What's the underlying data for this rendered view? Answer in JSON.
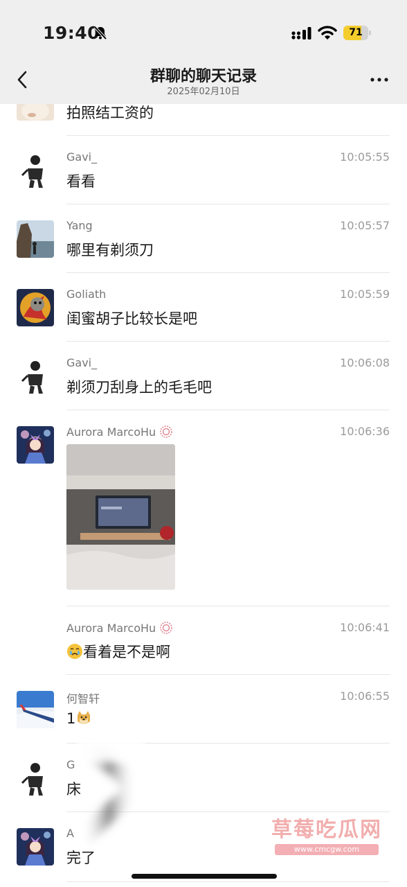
{
  "status_bar": {
    "time": "19:40",
    "battery": "71",
    "battery_level": 0.71
  },
  "header": {
    "title": "群聊的聊天记录",
    "subtitle": "2025年02月10日"
  },
  "messages": [
    {
      "sender": "",
      "time": "",
      "text": "拍照结工资的"
    },
    {
      "sender": "Gavi_",
      "time": "10:05:55",
      "text": "看看"
    },
    {
      "sender": "Yang",
      "time": "10:05:57",
      "text": "哪里有剃须刀"
    },
    {
      "sender": "Goliath",
      "time": "10:05:59",
      "text": "闺蜜胡子比较长是吧"
    },
    {
      "sender": "Gavi_",
      "time": "10:06:08",
      "text": "剃须刀刮身上的毛毛吧"
    },
    {
      "sender": "Aurora MarcoHu",
      "time": "10:06:36",
      "text": ""
    },
    {
      "sender": "Aurora MarcoHu",
      "time": "10:06:41",
      "text": "看着是不是啊"
    },
    {
      "sender": "何智轩",
      "time": "10:06:55",
      "text": "1"
    },
    {
      "sender": "G",
      "time": "",
      "text": "床"
    },
    {
      "sender": "A",
      "time": "",
      "text": "完了"
    }
  ],
  "watermark": {
    "title": "草莓吃瓜网",
    "url": "www.cmcgw.com"
  }
}
